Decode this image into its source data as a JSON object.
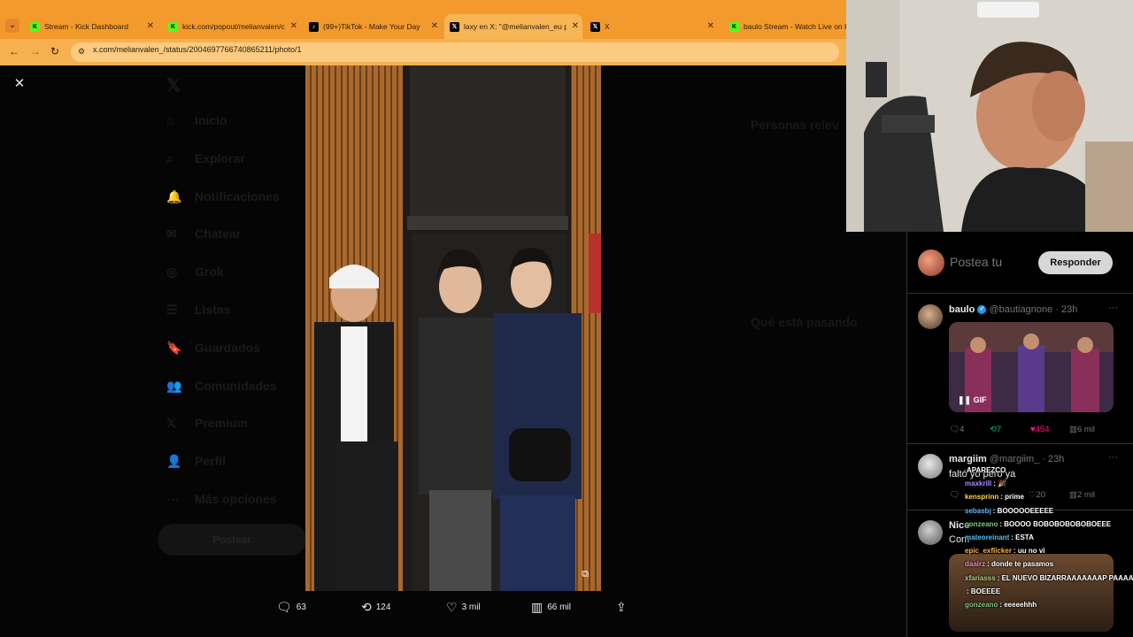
{
  "browser": {
    "tabs": [
      {
        "title": "Stream - Kick Dashboard",
        "icon": "kick-icon",
        "active": false
      },
      {
        "title": "kick.com/popout/melianvalen/c",
        "icon": "kick-icon",
        "active": false
      },
      {
        "title": "(99+)TikTok - Make Your Day",
        "icon": "tiktok-icon",
        "active": false
      },
      {
        "title": "laxy en X: \"@melianvalen_eu p",
        "icon": "x-icon",
        "active": true
      },
      {
        "title": "X",
        "icon": "x-icon",
        "active": false
      },
      {
        "title": "baulo Stream - Watch Live on K",
        "icon": "kick-icon",
        "active": false
      }
    ],
    "url": "x.com/melianvalen_/status/2004697766740865211/photo/1"
  },
  "background_nav": [
    "Inicio",
    "Explorar",
    "Notificaciones",
    "Chatear",
    "Grok",
    "Listas",
    "Guardados",
    "Comunidades",
    "Premium",
    "Perfil",
    "Más opciones"
  ],
  "background_post_button": "Postear",
  "background_right": {
    "heading1": "Personas relev",
    "heading2": "Qué está pasando"
  },
  "photo_actions": {
    "replies": "63",
    "reposts": "124",
    "likes": "3 mil",
    "views": "66 mil"
  },
  "sidebar": {
    "compose_placeholder": "Postea tu",
    "compose_button": "Responder",
    "posts": [
      {
        "name": "baulo",
        "handle": "@bautiagnone · 23h",
        "verified": true,
        "media_badge": "GIF",
        "stats": {
          "replies": "4",
          "reposts": "7",
          "likes": "454",
          "views": "6 mil"
        }
      },
      {
        "name": "margiim",
        "handle": "@margiim_ · 23h",
        "text": "faltó yo pero ya",
        "stats": {
          "replies": "",
          "reposts": "",
          "likes": "20",
          "views": "2 mil"
        }
      },
      {
        "name": "Nico",
        "text": "Com"
      }
    ]
  },
  "chat_messages": [
    {
      "user": "",
      "text": "APAREZCO",
      "color": "#ffffff"
    },
    {
      "user": "maxkrill",
      "text": ": 🎉",
      "color": "#b388ff"
    },
    {
      "user": "kensprinn",
      "text": ": prime",
      "color": "#ffd54f"
    },
    {
      "user": "sebasbj",
      "text": ": BOOOOOEEEEE",
      "color": "#64b5f6"
    },
    {
      "user": "gonzeano",
      "text": ": BOOOO BOBOBOBOBOBOEEE",
      "color": "#81c784"
    },
    {
      "user": "mateoreinant",
      "text": ": ESTA",
      "color": "#4fc3f7"
    },
    {
      "user": "epic_exflicker",
      "text": ": uu no vi",
      "color": "#ffb74d"
    },
    {
      "user": "daairz",
      "text": ": donde te pasamos",
      "color": "#f48fb1"
    },
    {
      "user": "xfariasss",
      "text": ": EL NUEVO BIZARRAAAAAAAP PAAAAA",
      "color": "#aed581"
    },
    {
      "user": "",
      "text": ": BOEEEE",
      "color": "#ef5350"
    },
    {
      "user": "gonzeano",
      "text": ": eeeeehhh",
      "color": "#81c784"
    }
  ]
}
